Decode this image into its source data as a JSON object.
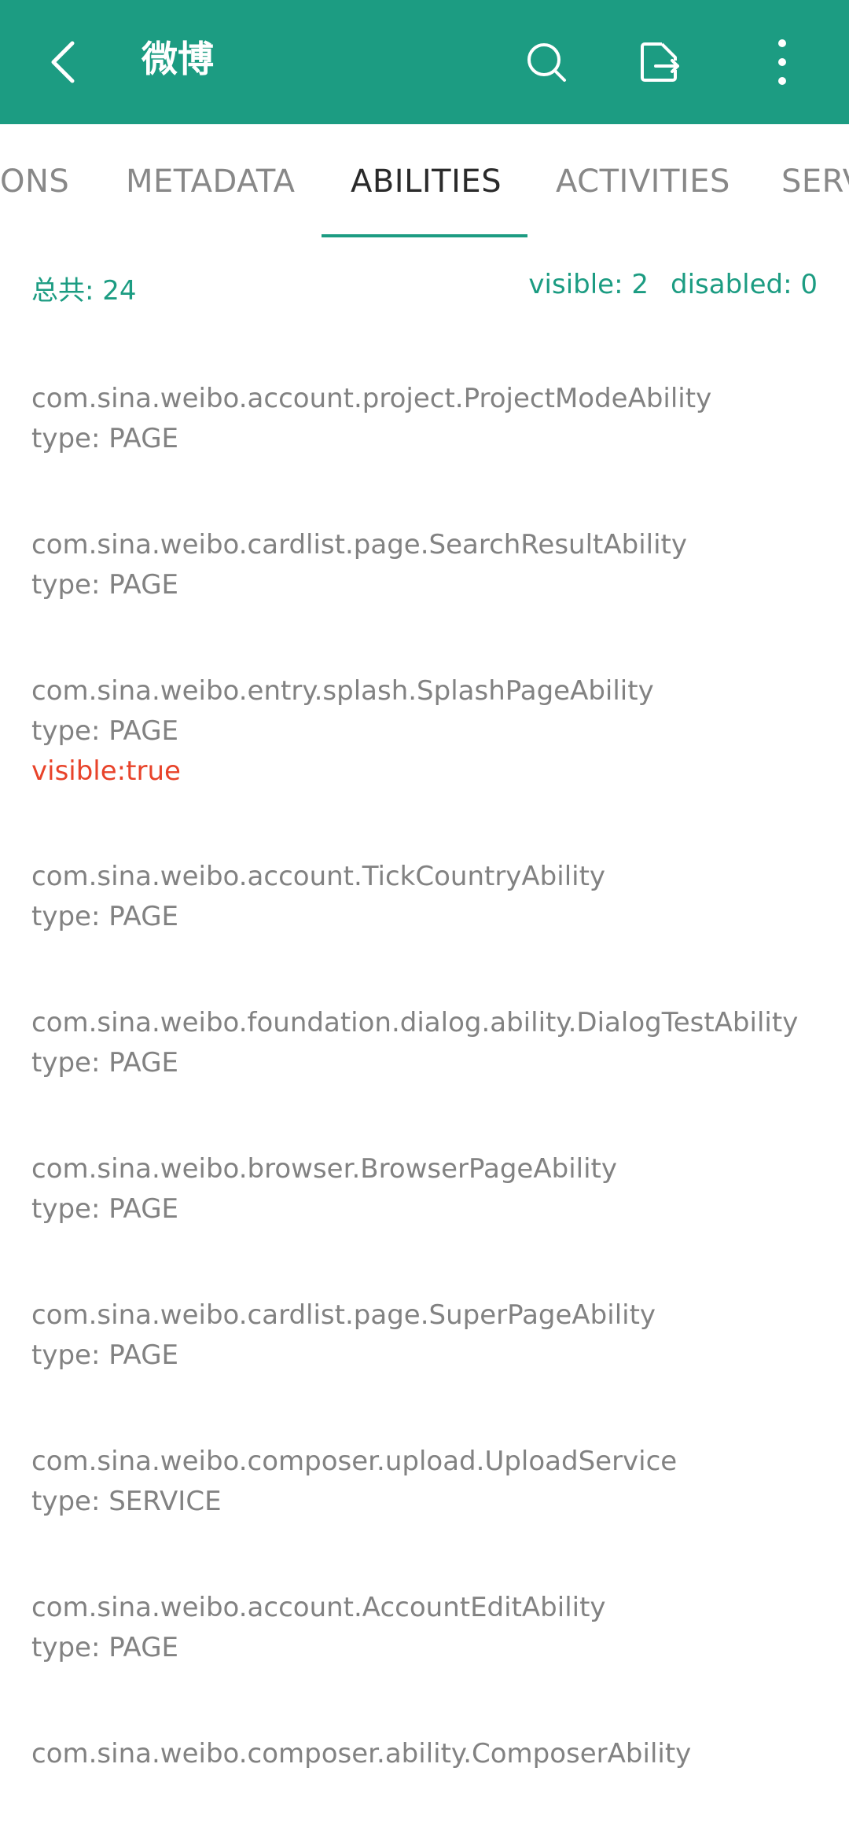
{
  "appbar": {
    "title": "微博",
    "background": "#1c9c82",
    "icons": [
      "back-arrow-icon",
      "search-icon",
      "export-icon",
      "more-vert-icon"
    ]
  },
  "tabs": [
    {
      "label": "ONS",
      "active": false
    },
    {
      "label": "METADATA",
      "active": false
    },
    {
      "label": "ABILITIES",
      "active": true
    },
    {
      "label": "ACTIVITIES",
      "active": false
    },
    {
      "label": "SERV",
      "active": false
    }
  ],
  "summary": {
    "total": "总共: 24",
    "visible": "visible: 2",
    "disabled": "disabled: 0"
  },
  "items": [
    {
      "name": "com.sina.weibo.account.project.ProjectModeAbility",
      "type": "type: PAGE"
    },
    {
      "name": "com.sina.weibo.cardlist.page.SearchResultAbility",
      "type": "type: PAGE"
    },
    {
      "name": "com.sina.weibo.entry.splash.SplashPageAbility",
      "type": "type: PAGE",
      "flag": "visible:true"
    },
    {
      "name": "com.sina.weibo.account.TickCountryAbility",
      "type": "type: PAGE"
    },
    {
      "name": "com.sina.weibo.foundation.dialog.ability.DialogTestAbility",
      "type": "type: PAGE"
    },
    {
      "name": "com.sina.weibo.browser.BrowserPageAbility",
      "type": "type: PAGE"
    },
    {
      "name": "com.sina.weibo.cardlist.page.SuperPageAbility",
      "type": "type: PAGE"
    },
    {
      "name": "com.sina.weibo.composer.upload.UploadService",
      "type": "type: SERVICE"
    },
    {
      "name": "com.sina.weibo.account.AccountEditAbility",
      "type": "type: PAGE"
    },
    {
      "name": "com.sina.weibo.composer.ability.ComposerAbility",
      "type": ""
    }
  ],
  "colors": {
    "accent": "#1c9c82",
    "flag": "#e8432a",
    "text_muted": "#828282"
  }
}
